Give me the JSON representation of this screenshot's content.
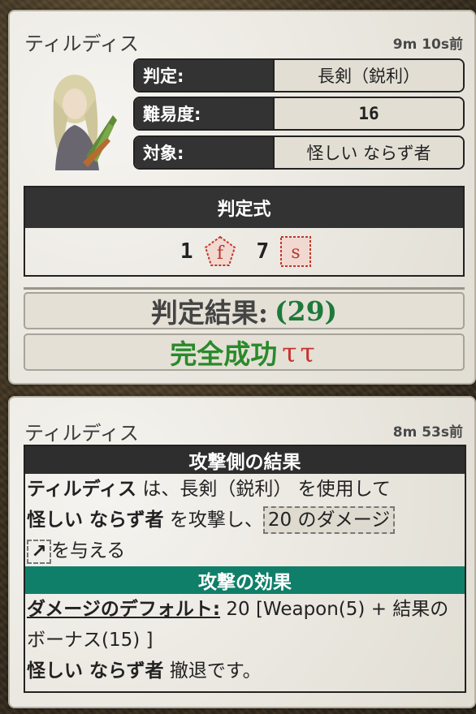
{
  "card1": {
    "speaker": "ティルディス",
    "timestamp": "9m 10s前",
    "rows": [
      {
        "label": "判定:",
        "value": "長剣（鋭利）"
      },
      {
        "label": "難易度:",
        "value": "16"
      },
      {
        "label": "対象:",
        "value": "怪しい ならず者"
      }
    ],
    "formula": {
      "title": "判定式",
      "dice": [
        {
          "count": "1",
          "face": "f",
          "shape": "pentagon"
        },
        {
          "count": "7",
          "face": "s",
          "shape": "square"
        }
      ]
    },
    "result": {
      "label": "判定結果:",
      "value": "(29)"
    },
    "outcome": {
      "text": "完全成功",
      "icons": "ττ"
    }
  },
  "card2": {
    "speaker": "ティルディス",
    "timestamp": "8m 53s前",
    "attack_header": "攻撃側の結果",
    "attack_lines": {
      "actor": "ティルディス",
      "t1": " は、長剣（鋭利） を使用して",
      "target": "怪しい ならず者",
      "t2": " を攻撃し、",
      "damage": "20 のダメージ",
      "t3": "を与える"
    },
    "effect_header": "攻撃の効果",
    "effect_lines": {
      "default_label": "ダメージのデフォルト:",
      "default_value": " 20 [Weapon(5) + 結果のボーナス(15) ]",
      "target": "怪しい ならず者",
      "retreat": " 撤退です。"
    }
  },
  "colors": {
    "teal": "#0f7f6a",
    "dark": "#2e2e2e",
    "success_green": "#1e7a3a",
    "icon_red": "#c8322f"
  }
}
